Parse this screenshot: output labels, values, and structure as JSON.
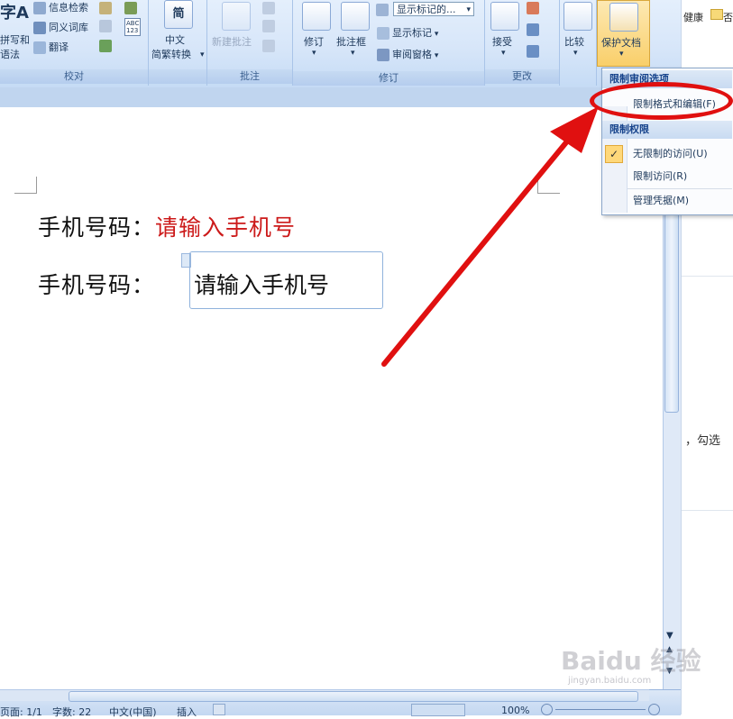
{
  "ribbon": {
    "proofing": {
      "big_label": "字A",
      "big_sub1": "拼写和",
      "big_sub2": "语法",
      "research": "信息检索",
      "thesaurus": "同义词库",
      "translate": "翻译",
      "abc": "ABC\n123",
      "group_label": "校对"
    },
    "chinese": {
      "icon_glyph": "简",
      "label1": "中文",
      "label2": "简繁转换",
      "group_label": ""
    },
    "comments": {
      "new_comment": "新建批注",
      "group_label": "批注"
    },
    "tracking": {
      "track_changes": "修订",
      "balloons": "批注框",
      "display_combo": "显示标记的...",
      "show_markup": "显示标记",
      "reviewing_pane": "审阅窗格",
      "group_label": "修订"
    },
    "changes": {
      "accept": "接受",
      "group_label": "更改"
    },
    "compare": {
      "label": "比较"
    },
    "protect": {
      "label": "保护文档"
    }
  },
  "right_pane": {
    "top_text": "健康",
    "top_text2": "否",
    "mid_text": "，勾选"
  },
  "document": {
    "line1_label": "手机号码：",
    "line1_value": "请输入手机号",
    "line2_label": "手机号码：",
    "line2_value": "请输入手机号"
  },
  "menu": {
    "section1_title": "限制审阅选项",
    "item_restrict_format": "限制格式和编辑(F)",
    "section2_title": "限制权限",
    "item_unrestricted": "无限制的访问(U)",
    "item_restricted": "限制访问(R)",
    "item_manage": "管理凭据(M)",
    "check_glyph": "✓"
  },
  "status": {
    "page": "页面: 1/1",
    "words": "字数: 22",
    "language": "中文(中国)",
    "mode": "插入",
    "zoom": "100%"
  },
  "watermark": {
    "main": "Baidu 经验",
    "sub": "jingyan.baidu.com"
  },
  "colors": {
    "accent_red": "#e01010",
    "placeholder_red": "#cc1a1a",
    "ribbon_blue": "#d7e6f9"
  }
}
